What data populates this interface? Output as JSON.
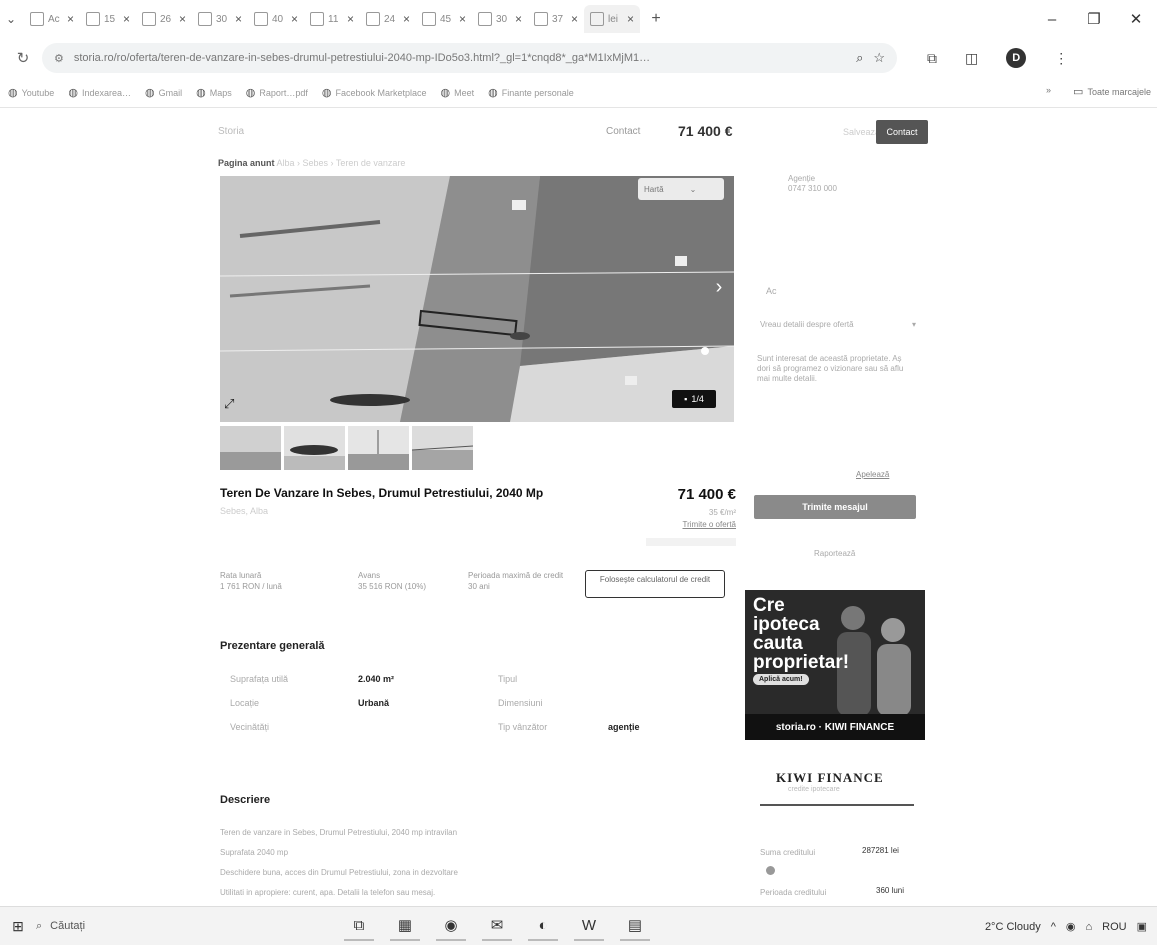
{
  "browser": {
    "tabs": [
      {
        "label": "Ac"
      },
      {
        "label": "15"
      },
      {
        "label": "26"
      },
      {
        "label": "30"
      },
      {
        "label": "40"
      },
      {
        "label": "11"
      },
      {
        "label": "24"
      },
      {
        "label": "45"
      },
      {
        "label": "30"
      },
      {
        "label": "37"
      },
      {
        "label": "lei",
        "active": true
      }
    ],
    "new_tab": "+",
    "controls": {
      "minimize": "–",
      "maximize": "❐",
      "close": "✕"
    },
    "url": "storia.ro/ro/oferta/teren-de-vanzare-in-sebes-drumul-petrestiului-2040-mp-IDo5o3.html?_gl=1*cnqd8*_ga*M1IxMjM1…",
    "bookmarks": [
      "Youtube",
      "Indexarea…",
      "Gmail",
      "Maps",
      "Raport…pdf",
      "Facebook Marketplace",
      "Meet",
      "Finante personale"
    ],
    "bookmarks_more": "»",
    "bookmarks_folder": "Toate marcajele"
  },
  "header": {
    "left_text": "Storia",
    "phone": "Contact",
    "price": "71 400 €",
    "fav": "Salvează",
    "contact_btn": "Contact"
  },
  "breadcrumb": {
    "bold": "Pagina anunt",
    "rest": "Alba › Sebes › Teren de vanzare"
  },
  "gallery": {
    "map_label": "Hartă",
    "counter": "1/4"
  },
  "listing": {
    "title": "Teren De Vanzare In Sebes, Drumul Petrestiului, 2040 Mp",
    "address": "Sebes, Alba",
    "price": "71 400 €",
    "price_per_m2": "35 €/m²",
    "offer_link": "Trimite o ofertă",
    "financing": [
      {
        "label": "Rata lunară",
        "value": "1 761 RON / lună"
      },
      {
        "label": "Avans",
        "value": "35 516 RON (10%)"
      },
      {
        "label": "Perioada maximă de credit",
        "value": "30 ani"
      }
    ],
    "calc_button": "Folosește calculatorul de credit"
  },
  "overview": {
    "title": "Prezentare generală",
    "rows": [
      {
        "label": "Suprafața utilă",
        "value": "2.040 m²",
        "label2": "Tipul",
        "value2": ""
      },
      {
        "label": "Locație",
        "value": "Urbană",
        "label2": "Dimensiuni",
        "value2": ""
      },
      {
        "label": "Vecinătăți",
        "value": "",
        "label2": "Tip vânzător",
        "value2": "agenție"
      }
    ]
  },
  "description": {
    "title": "Descriere",
    "lines": [
      "Teren de vanzare in Sebes, Drumul Petrestiului, 2040 mp intravilan",
      "Suprafata 2040 mp",
      "Deschidere buna, acces din Drumul Petrestiului, zona in dezvoltare",
      "Utilitati in apropiere: curent, apa. Detalii la telefon sau mesaj."
    ]
  },
  "sidebar": {
    "agency_label": "Agenție",
    "agency_phone": "0747 310 000",
    "name_label": "Ac",
    "select_value": "Vreau detalii despre ofertă",
    "select_arrow": "▾",
    "message": "Sunt interesat de această proprietate. Aș dori să programez o vizionare sau să aflu mai multe detalii.",
    "link": "Apelează",
    "send_btn": "Trimite mesajul",
    "report": "Raportează",
    "ad_text": "Cre ipoteca cauta proprietar!",
    "ad_cta": "Aplică acum!",
    "ad_brand": "storia.ro · KIWI FINANCE",
    "kiwi_logo": "KIWI FINANCE",
    "kiwi_sub": "credite ipotecare",
    "kiwi_rows": [
      {
        "label": "Suma creditului",
        "value": "287281 lei"
      },
      {
        "label": "Perioada creditului",
        "value": "360 luni"
      }
    ]
  },
  "taskbar": {
    "search": "Căutați",
    "weather": "2°C Cloudy",
    "lang": "ROU"
  }
}
